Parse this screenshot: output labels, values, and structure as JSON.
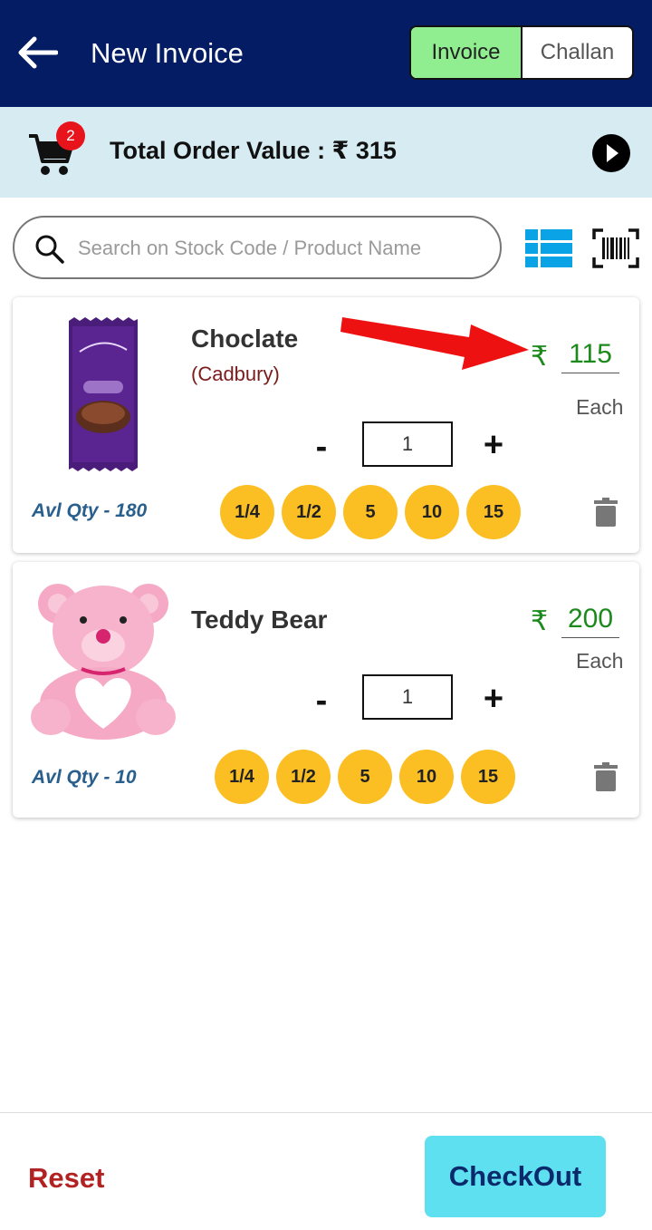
{
  "header": {
    "title": "New Invoice",
    "tabs": [
      {
        "label": "Invoice",
        "active": true
      },
      {
        "label": "Challan",
        "active": false
      }
    ],
    "bg_color": "#041c63"
  },
  "order_bar": {
    "cart_count": "2",
    "total_label": "Total Order Value : ₹ 315"
  },
  "search": {
    "placeholder": "Search on Stock Code / Product Name",
    "value": ""
  },
  "products": [
    {
      "name": "Choclate",
      "brand": "(Cadbury)",
      "currency": "₹",
      "price": "115",
      "price_unit": "Each",
      "qty": "1",
      "minus": "-",
      "plus": "+",
      "avl_qty": "Avl Qty - 180",
      "quick_qty": [
        "1/4",
        "1/2",
        "5",
        "10",
        "15"
      ],
      "image_icon": "chocolate-bar-image"
    },
    {
      "name": "Teddy Bear",
      "brand": "",
      "currency": "₹",
      "price": "200",
      "price_unit": "Each",
      "qty": "1",
      "minus": "-",
      "plus": "+",
      "avl_qty": "Avl Qty - 10",
      "quick_qty": [
        "1/4",
        "1/2",
        "5",
        "10",
        "15"
      ],
      "image_icon": "teddy-bear-image"
    }
  ],
  "footer": {
    "reset_label": "Reset",
    "checkout_label": "CheckOut"
  },
  "colors": {
    "accent_green": "#90ee90",
    "chip_yellow": "#fbbf24",
    "price_green": "#1b8a1b",
    "checkout_cyan": "#5ee0f0",
    "reset_red": "#b22222",
    "annotation_red": "#ee1111"
  }
}
